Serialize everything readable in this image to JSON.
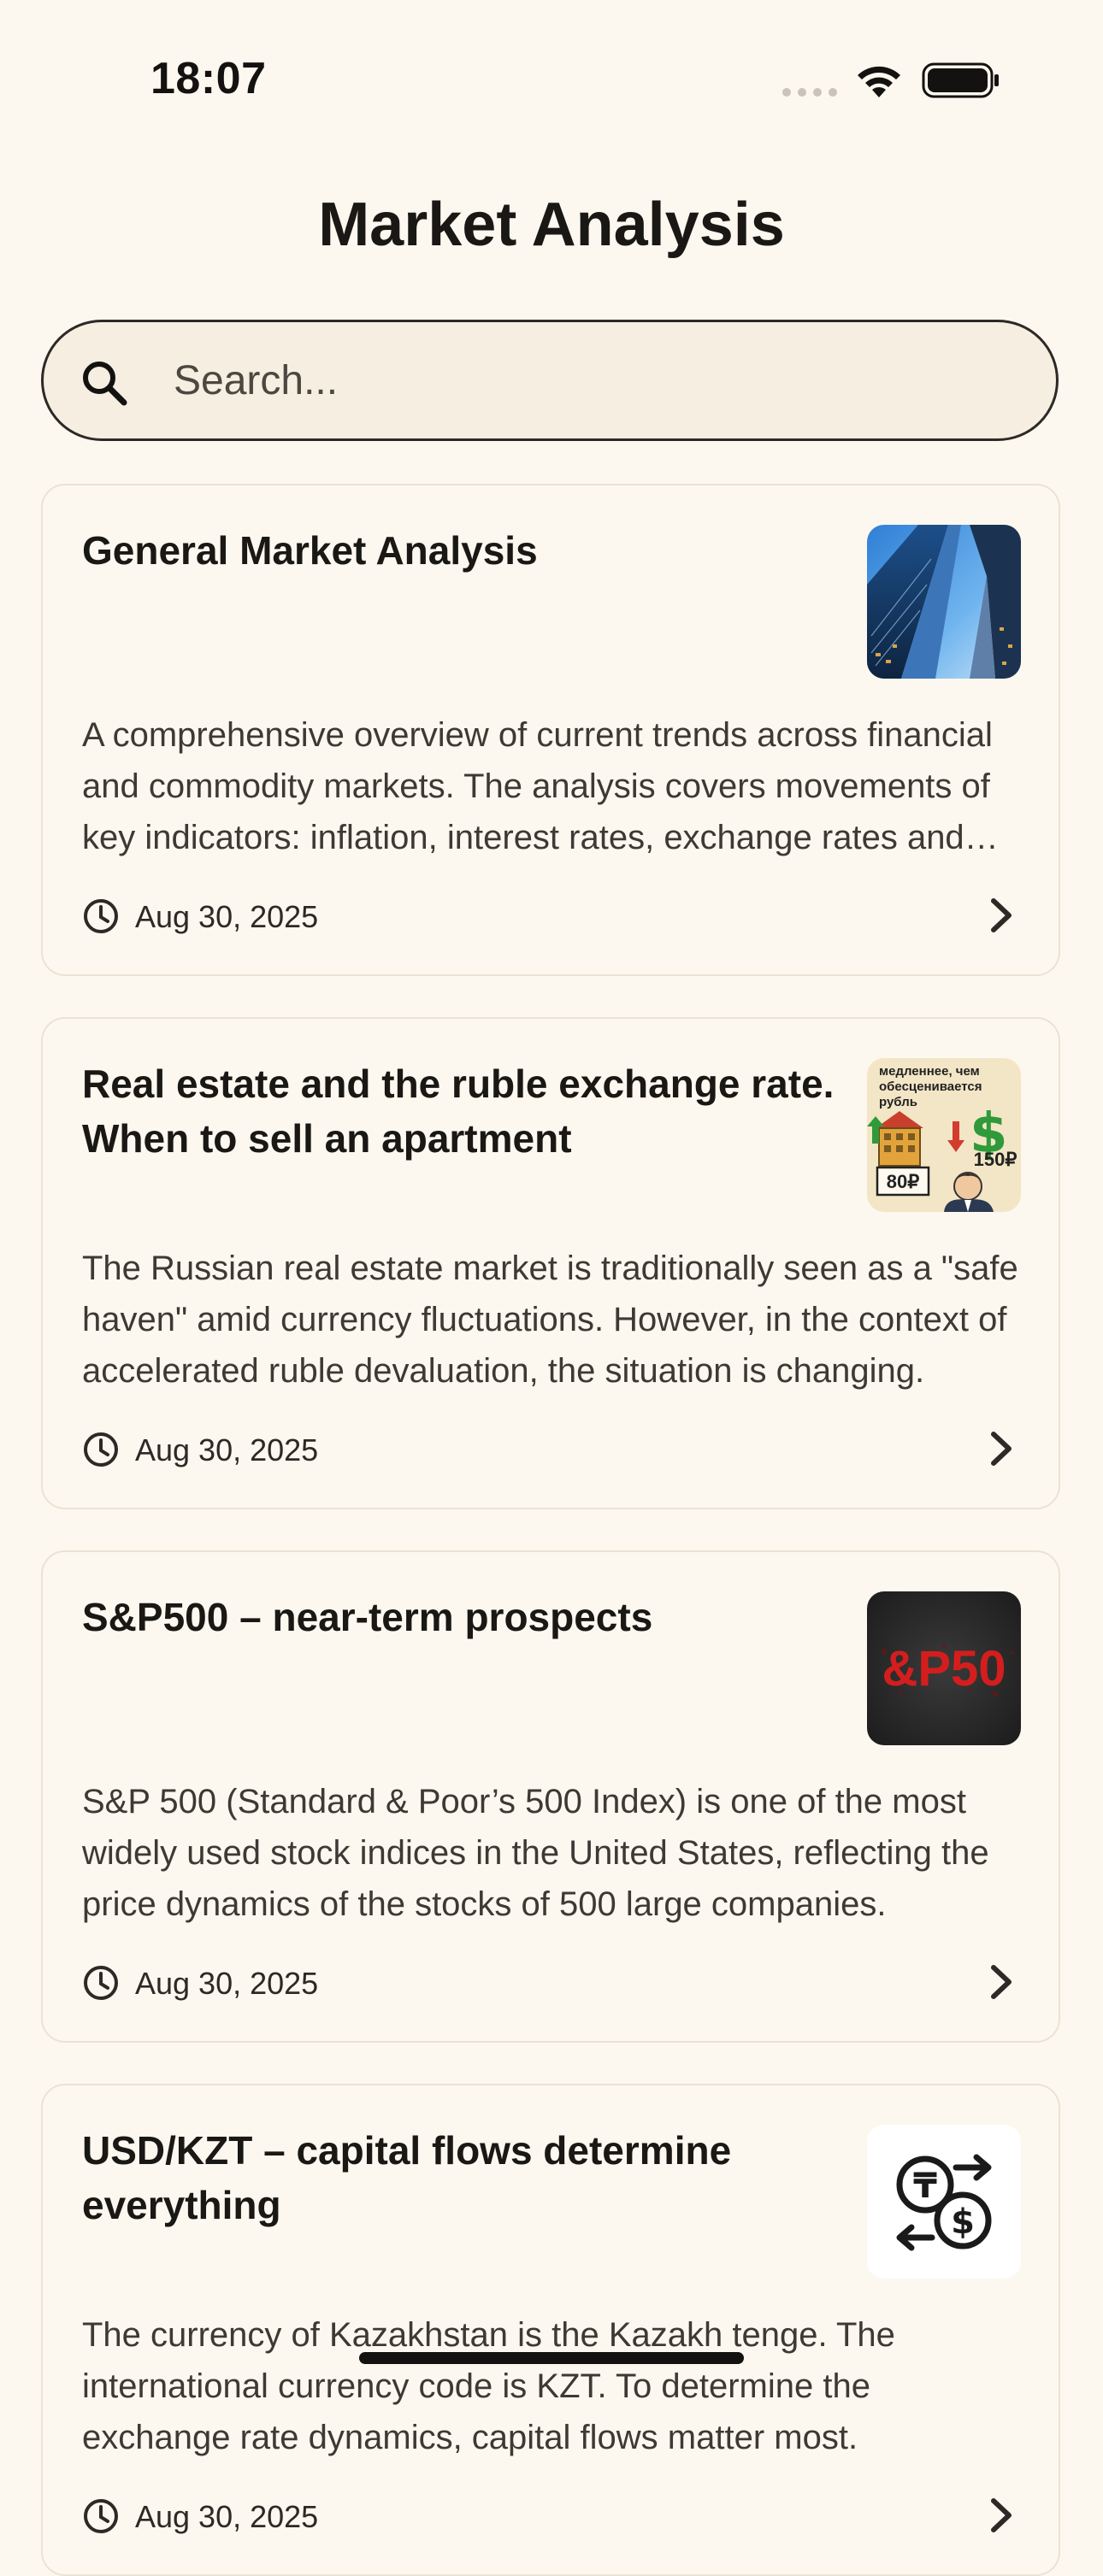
{
  "status_bar": {
    "time": "18:07",
    "icons": [
      "signal-dots-icon",
      "wifi-icon",
      "battery-icon"
    ]
  },
  "header": {
    "title": "Market Analysis"
  },
  "search": {
    "placeholder": "Search...",
    "value": "",
    "icon": "search-icon"
  },
  "articles": [
    {
      "title": "General Market Analysis",
      "description": "A comprehensive overview of current trends across financial and commodity markets. The analysis covers movements of key indicators: inflation, interest rates, exchange rates and commodity prices.",
      "date": "Aug 30, 2025",
      "thumbnail": "skyscrapers-photo"
    },
    {
      "title": "Real estate and the ruble exchange rate. When to sell an apartment",
      "description": "The Russian real estate market is traditionally seen as a \"safe haven\" amid currency fluctuations. However, in the context of accelerated ruble devaluation, the situation is changing.",
      "date": "Aug 30, 2025",
      "thumbnail": "real-estate-illustration",
      "thumbnail_text": {
        "caption": "медленнее, чем обесценивается рубль",
        "price_low": "80₽",
        "price_high": "150₽"
      }
    },
    {
      "title": "S&P500 – near-term prospects",
      "description": "S&P 500 (Standard & Poor’s 500 Index) is one of the most widely used stock indices in the United States, reflecting the price dynamics of the stocks of 500 large companies.",
      "date": "Aug 30, 2025",
      "thumbnail": "sp500-logo",
      "thumbnail_text": {
        "logo": "&P50"
      }
    },
    {
      "title": "USD/KZT – capital flows determine everything",
      "description": "The currency of Kazakhstan is the Kazakh tenge. The international currency code is KZT. To determine the exchange rate dynamics, capital flows matter most.",
      "date": "Aug 30, 2025",
      "thumbnail": "currency-exchange-icon"
    }
  ],
  "colors": {
    "background": "#fdf8ef",
    "search_background": "#f5eee1",
    "card_border": "#ebe2d3",
    "text_primary": "#1a1815",
    "text_secondary": "#3d3934"
  }
}
